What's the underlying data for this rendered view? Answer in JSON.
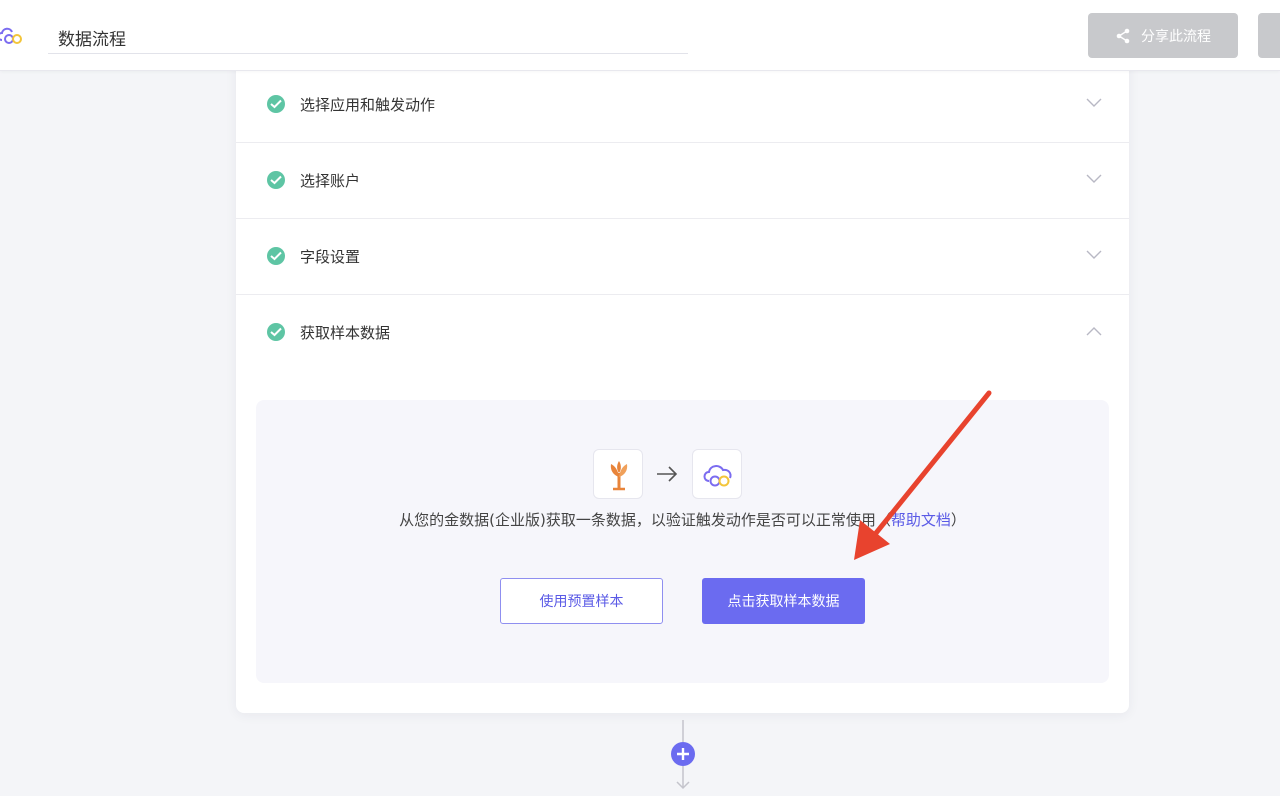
{
  "header": {
    "flow_title": "数据流程",
    "share_label": "分享此流程"
  },
  "steps": [
    {
      "label": "选择应用和触发动作",
      "status": "done",
      "expanded": false
    },
    {
      "label": "选择账户",
      "status": "done",
      "expanded": false
    },
    {
      "label": "字段设置",
      "status": "done",
      "expanded": false
    },
    {
      "label": "获取样本数据",
      "status": "done",
      "expanded": true
    }
  ],
  "sample": {
    "description": "从您的金数据(企业版)获取一条数据，以验证触发动作是否可以正常使用",
    "help_open": "（",
    "help_link": "帮助文档",
    "help_close": "）",
    "use_preset_label": "使用预置样本",
    "fetch_label": "点击获取样本数据",
    "source_app_icon": "jinshuju-tree-icon",
    "target_app_icon": "cloud-infinity-logo-icon"
  },
  "colors": {
    "accent": "#6b6bf0",
    "check": "#5ec5a4",
    "annotation_arrow": "#e8432e"
  }
}
